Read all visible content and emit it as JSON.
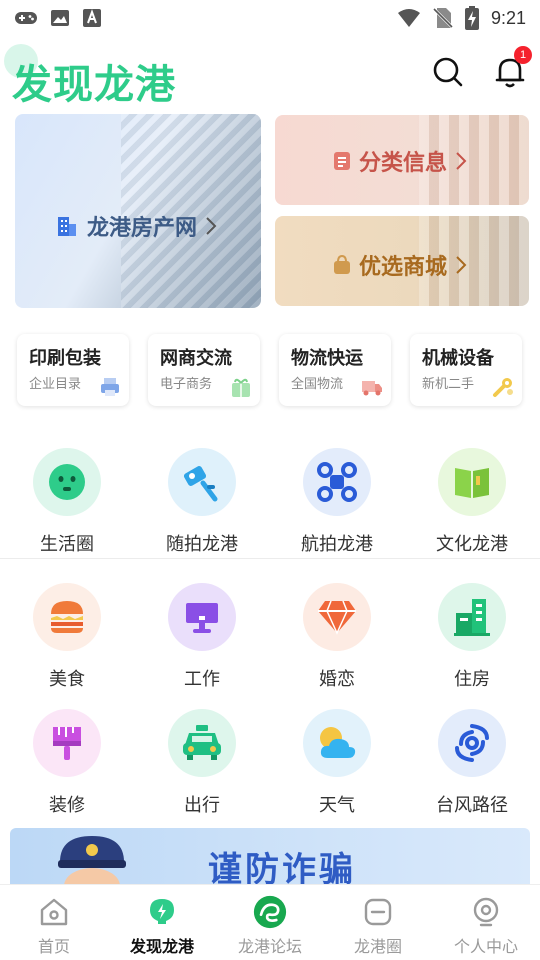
{
  "status_bar": {
    "time": "9:21",
    "left_icons": [
      "gamepad-icon",
      "image-icon",
      "a-font-icon"
    ],
    "right_icons": [
      "wifi-icon",
      "no-sim-icon",
      "battery-charging-icon"
    ]
  },
  "header": {
    "title": "发现龙港",
    "notification_count": "1",
    "accent": "#2ecc8a"
  },
  "banners": {
    "big": {
      "label": "龙港房产网",
      "icon": "building-icon"
    },
    "small": [
      {
        "label": "分类信息",
        "icon": "document-icon"
      },
      {
        "label": "优选商城",
        "icon": "shopping-bag-icon"
      }
    ]
  },
  "categories": [
    {
      "title": "印刷包装",
      "sub": "企业目录",
      "icon": "printer-icon"
    },
    {
      "title": "网商交流",
      "sub": "电子商务",
      "icon": "gift-icon"
    },
    {
      "title": "物流快运",
      "sub": "全国物流",
      "icon": "truck-icon"
    },
    {
      "title": "机械设备",
      "sub": "新机二手",
      "icon": "wrench-icon"
    }
  ],
  "grid": {
    "row1": [
      {
        "label": "生活圈",
        "icon": "smiley-icon"
      },
      {
        "label": "随拍龙港",
        "icon": "selfie-stick-icon"
      },
      {
        "label": "航拍龙港",
        "icon": "drone-icon"
      },
      {
        "label": "文化龙港",
        "icon": "book-icon"
      }
    ],
    "row2": [
      {
        "label": "美食",
        "icon": "burger-icon"
      },
      {
        "label": "工作",
        "icon": "computer-icon"
      },
      {
        "label": "婚恋",
        "icon": "diamond-icon"
      },
      {
        "label": "住房",
        "icon": "buildings-icon"
      }
    ],
    "row3": [
      {
        "label": "装修",
        "icon": "paint-brush-icon"
      },
      {
        "label": "出行",
        "icon": "taxi-icon"
      },
      {
        "label": "天气",
        "icon": "sun-cloud-icon"
      },
      {
        "label": "台风路径",
        "icon": "typhoon-icon"
      }
    ]
  },
  "promo": {
    "text": "谨防诈骗"
  },
  "tabs": [
    {
      "label": "首页",
      "icon": "home-icon",
      "active": false
    },
    {
      "label": "发现龙港",
      "icon": "discover-icon",
      "active": true
    },
    {
      "label": "龙港论坛",
      "icon": "dragon-logo-icon",
      "active": false
    },
    {
      "label": "龙港圈",
      "icon": "circle-icon",
      "active": false
    },
    {
      "label": "个人中心",
      "icon": "profile-icon",
      "active": false
    }
  ]
}
